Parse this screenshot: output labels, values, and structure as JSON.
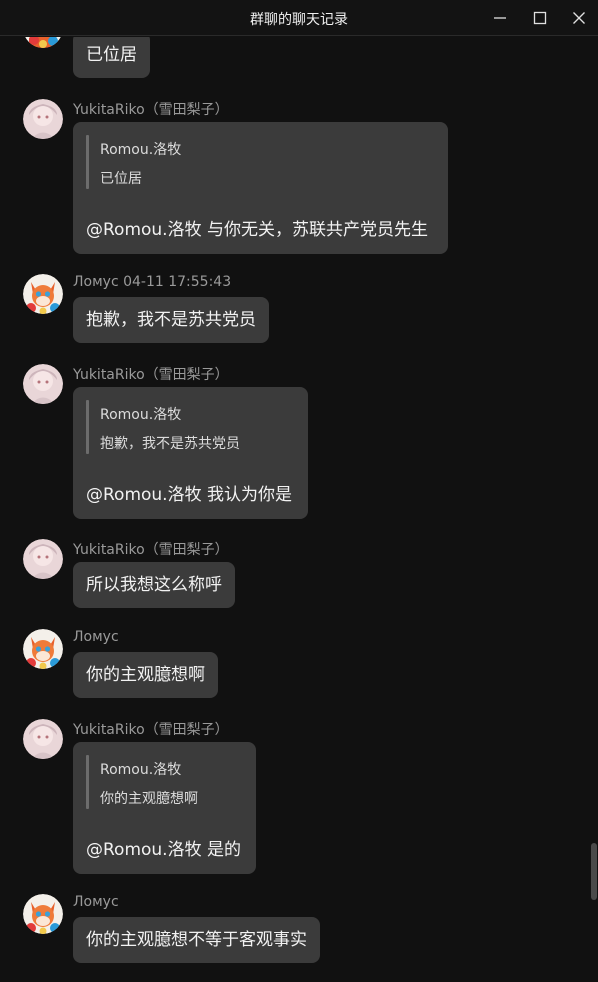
{
  "window": {
    "title": "群聊的聊天记录",
    "controls": [
      "minimize-icon",
      "maximize-icon",
      "close-icon"
    ]
  },
  "messages": [
    {
      "sender": "",
      "avatar": "fox-avatar",
      "text": "已位居"
    },
    {
      "sender": "YukitaRiko（雪田梨子）",
      "avatar": "girl-avatar",
      "quote": {
        "author": "Romou.洛牧",
        "text": "已位居"
      },
      "text": "@Romou.洛牧 与你无关，苏联共产党员先生"
    },
    {
      "sender": "Ломус 04-11 17:55:43",
      "avatar": "fox-avatar",
      "text": "抱歉，我不是苏共党员"
    },
    {
      "sender": "YukitaRiko（雪田梨子）",
      "avatar": "girl-avatar",
      "quote": {
        "author": "Romou.洛牧",
        "text": "抱歉，我不是苏共党员"
      },
      "text": "@Romou.洛牧 我认为你是"
    },
    {
      "sender": "YukitaRiko（雪田梨子）",
      "avatar": "girl-avatar",
      "text": "所以我想这么称呼"
    },
    {
      "sender": "Ломус",
      "avatar": "fox-avatar",
      "text": "你的主观臆想啊"
    },
    {
      "sender": "YukitaRiko（雪田梨子）",
      "avatar": "girl-avatar",
      "quote": {
        "author": "Romou.洛牧",
        "text": "你的主观臆想啊"
      },
      "text": "@Romou.洛牧 是的"
    },
    {
      "sender": "Ломус",
      "avatar": "fox-avatar",
      "text": "你的主观臆想不等于客观事实"
    }
  ],
  "colors": {
    "background": "#111111",
    "bubble": "#3b3b3b",
    "sender_text": "#9a9a9a",
    "message_text": "#f2f2f2"
  }
}
